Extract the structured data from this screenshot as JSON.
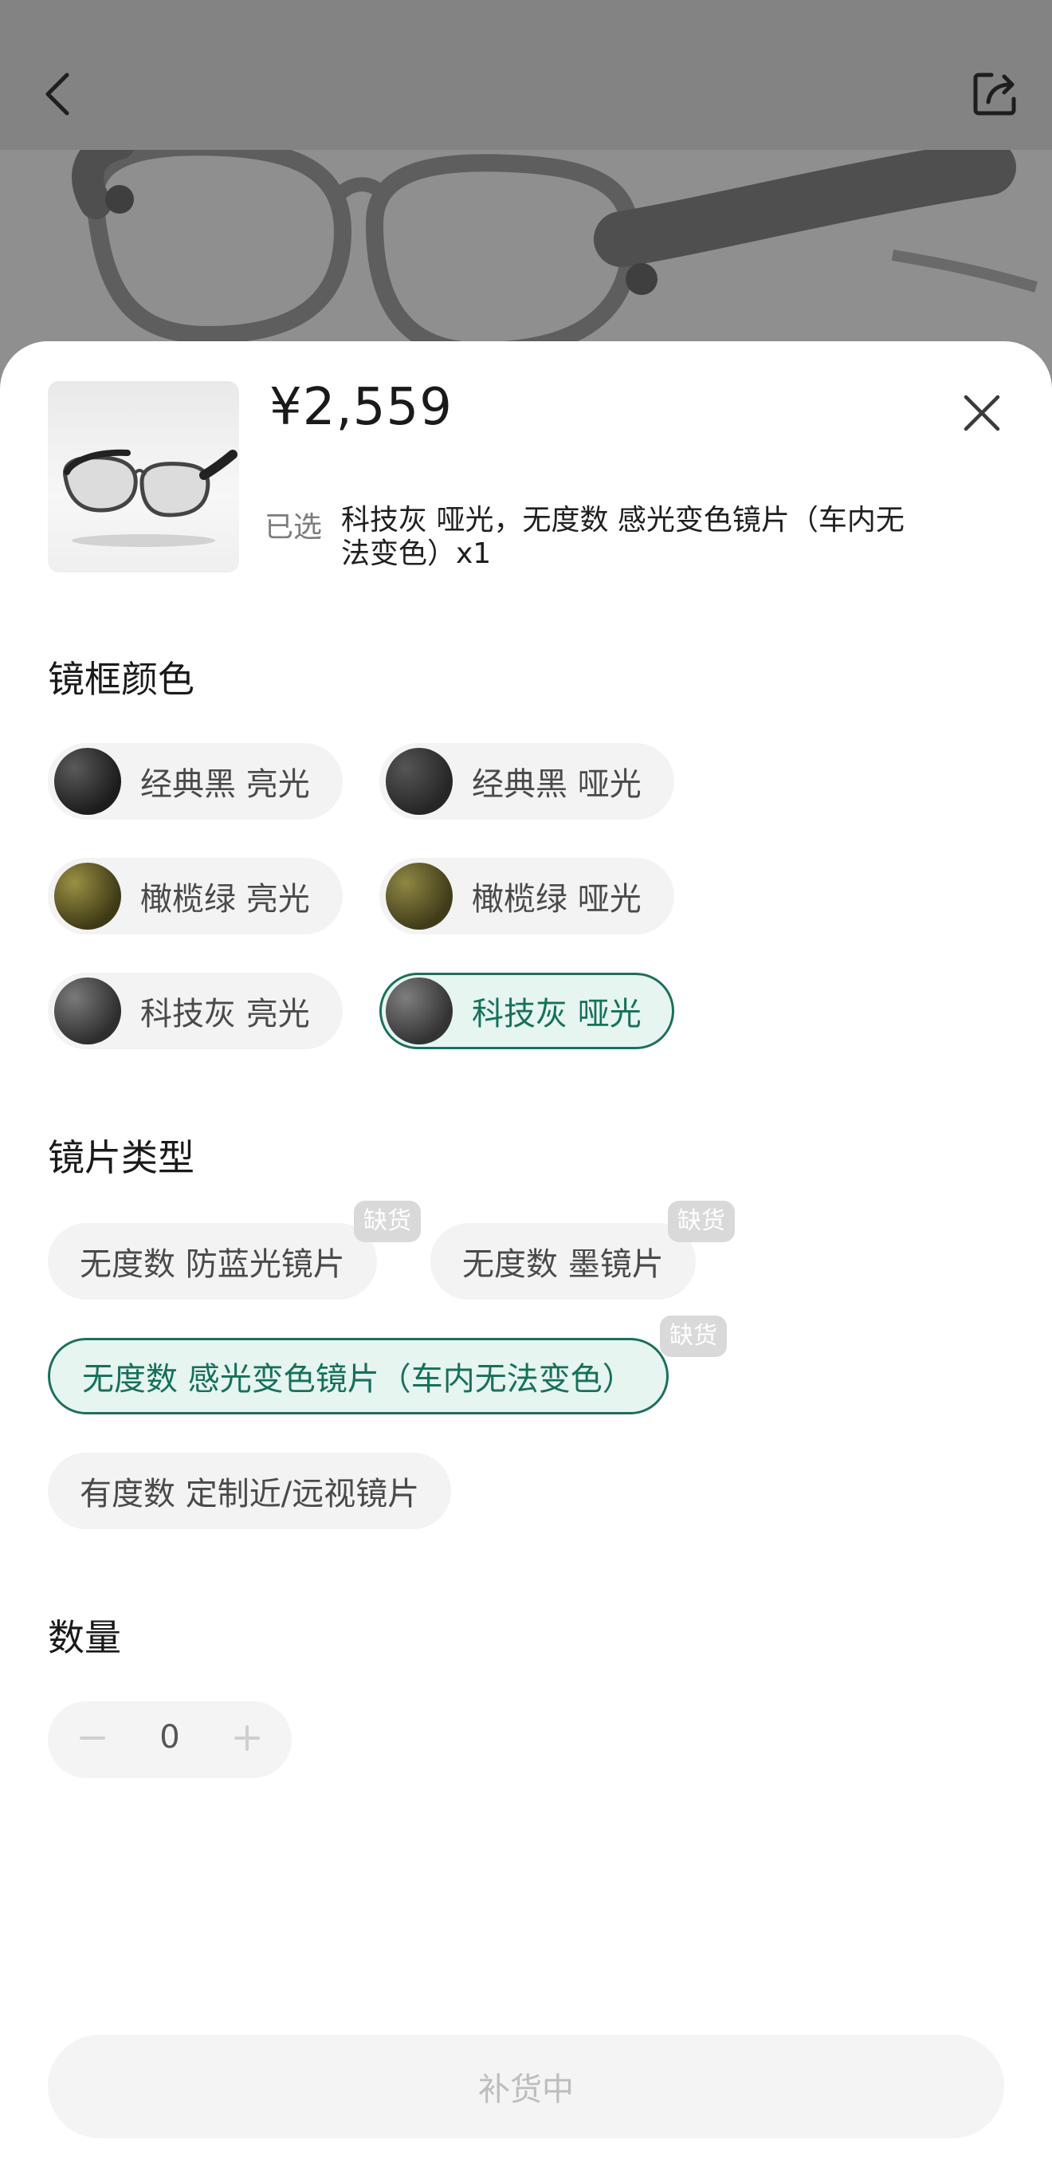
{
  "header": {
    "back_icon": "chevron-left-icon",
    "share_icon": "share-icon"
  },
  "product": {
    "price": "¥2,559",
    "selected_label": "已选",
    "selected_value": "科技灰 哑光，无度数 感光变色镜片（车内无法变色）x1"
  },
  "frame_color": {
    "title": "镜框颜色",
    "options": [
      {
        "label": "经典黑 亮光",
        "swatch": "#2b2b2b",
        "selected": false
      },
      {
        "label": "经典黑 哑光",
        "swatch": "#333333",
        "selected": false
      },
      {
        "label": "橄榄绿 亮光",
        "swatch": "#5f5a28",
        "selected": false
      },
      {
        "label": "橄榄绿 哑光",
        "swatch": "#615b2c",
        "selected": false
      },
      {
        "label": "科技灰 亮光",
        "swatch": "#4a4a4a",
        "selected": false
      },
      {
        "label": "科技灰 哑光",
        "swatch": "#4d4d4d",
        "selected": true
      }
    ]
  },
  "lens_type": {
    "title": "镜片类型",
    "options": [
      {
        "label": "无度数 防蓝光镜片",
        "badge": "缺货",
        "selected": false
      },
      {
        "label": "无度数 墨镜片",
        "badge": "缺货",
        "selected": false
      },
      {
        "label": "无度数 感光变色镜片（车内无法变色）",
        "badge": "缺货",
        "selected": true
      },
      {
        "label": "有度数 定制近/远视镜片",
        "badge": "",
        "selected": false
      }
    ]
  },
  "quantity": {
    "title": "数量",
    "value": "0"
  },
  "action": {
    "button_label": "补货中"
  },
  "colors": {
    "accent": "#1d6f5c",
    "accent_bg": "#e6f5f0",
    "chip_bg": "#f3f3f3",
    "badge_bg": "#d9d9d9"
  }
}
